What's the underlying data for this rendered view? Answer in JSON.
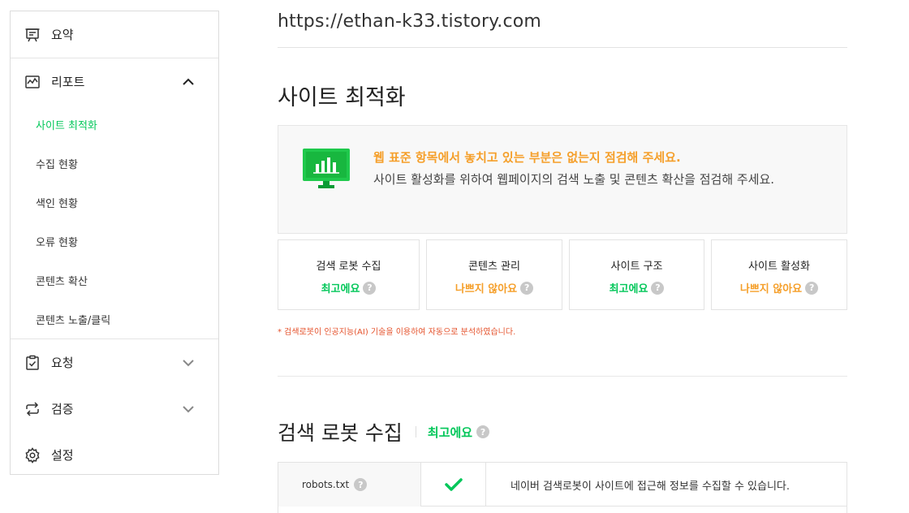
{
  "sidebar": {
    "summary": "요약",
    "report": "리포트",
    "report_items": [
      "사이트 최적화",
      "수집 현황",
      "색인 현황",
      "오류 현황",
      "콘텐츠 확산",
      "콘텐츠 노출/클릭"
    ],
    "request": "요청",
    "verify": "검증",
    "settings": "설정"
  },
  "main": {
    "url": "https://ethan-k33.tistory.com",
    "title": "사이트 최적화",
    "notice_title": "웹 표준 항목에서 놓치고 있는 부분은 없는지 점검해 주세요.",
    "notice_desc": "사이트 활성화를 위하여 웹페이지의 검색 노출 및 콘텐츠 확산을 점검해 주세요.",
    "cards": [
      {
        "title": "검색 로봇 수집",
        "status": "최고에요",
        "tone": "green"
      },
      {
        "title": "콘텐츠 관리",
        "status": "나쁘지 않아요",
        "tone": "orange"
      },
      {
        "title": "사이트 구조",
        "status": "최고에요",
        "tone": "green"
      },
      {
        "title": "사이트 활성화",
        "status": "나쁘지 않아요",
        "tone": "orange"
      }
    ],
    "ai_note": "* 검색로봇이 인공지능(AI) 기술을 이용하여 자동으로 분석하였습니다.",
    "section_title": "검색 로봇 수집",
    "section_status": "최고에요",
    "table": {
      "row1_key": "robots.txt",
      "row1_msg": "네이버 검색로봇이 사이트에 접근해 정보를 수집할 수 있습니다."
    },
    "qmark": "?"
  },
  "colors": {
    "green": "#03c75a",
    "orange": "#f59f2a",
    "note_red": "#e5532d"
  }
}
